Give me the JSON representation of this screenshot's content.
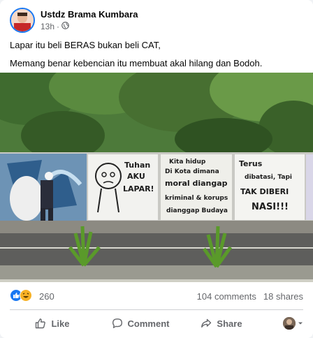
{
  "post": {
    "author": "Ustdz Brama Kumbara",
    "time": "13h",
    "lines": [
      "Lapar itu beli BERAS bukan beli CAT,",
      "Memang benar kebencian itu membuat akal hilang dan Bodoh."
    ]
  },
  "image": {
    "graffiti": {
      "panel1": [
        "Tuhan",
        "AKU",
        "LAPAR!"
      ],
      "panel2": [
        "Kita hidup",
        "Di Kota dimana",
        "moral diangap",
        "kriminal & korups",
        "dianggap Budaya"
      ],
      "panel3": [
        "Terus",
        "dibatasi, Tapi",
        "TAK DIBERI",
        "NASI!!!"
      ]
    }
  },
  "engagement": {
    "reaction_count": "260",
    "comments": "104 comments",
    "shares": "18 shares"
  },
  "actions": {
    "like": "Like",
    "comment": "Comment",
    "share": "Share"
  }
}
